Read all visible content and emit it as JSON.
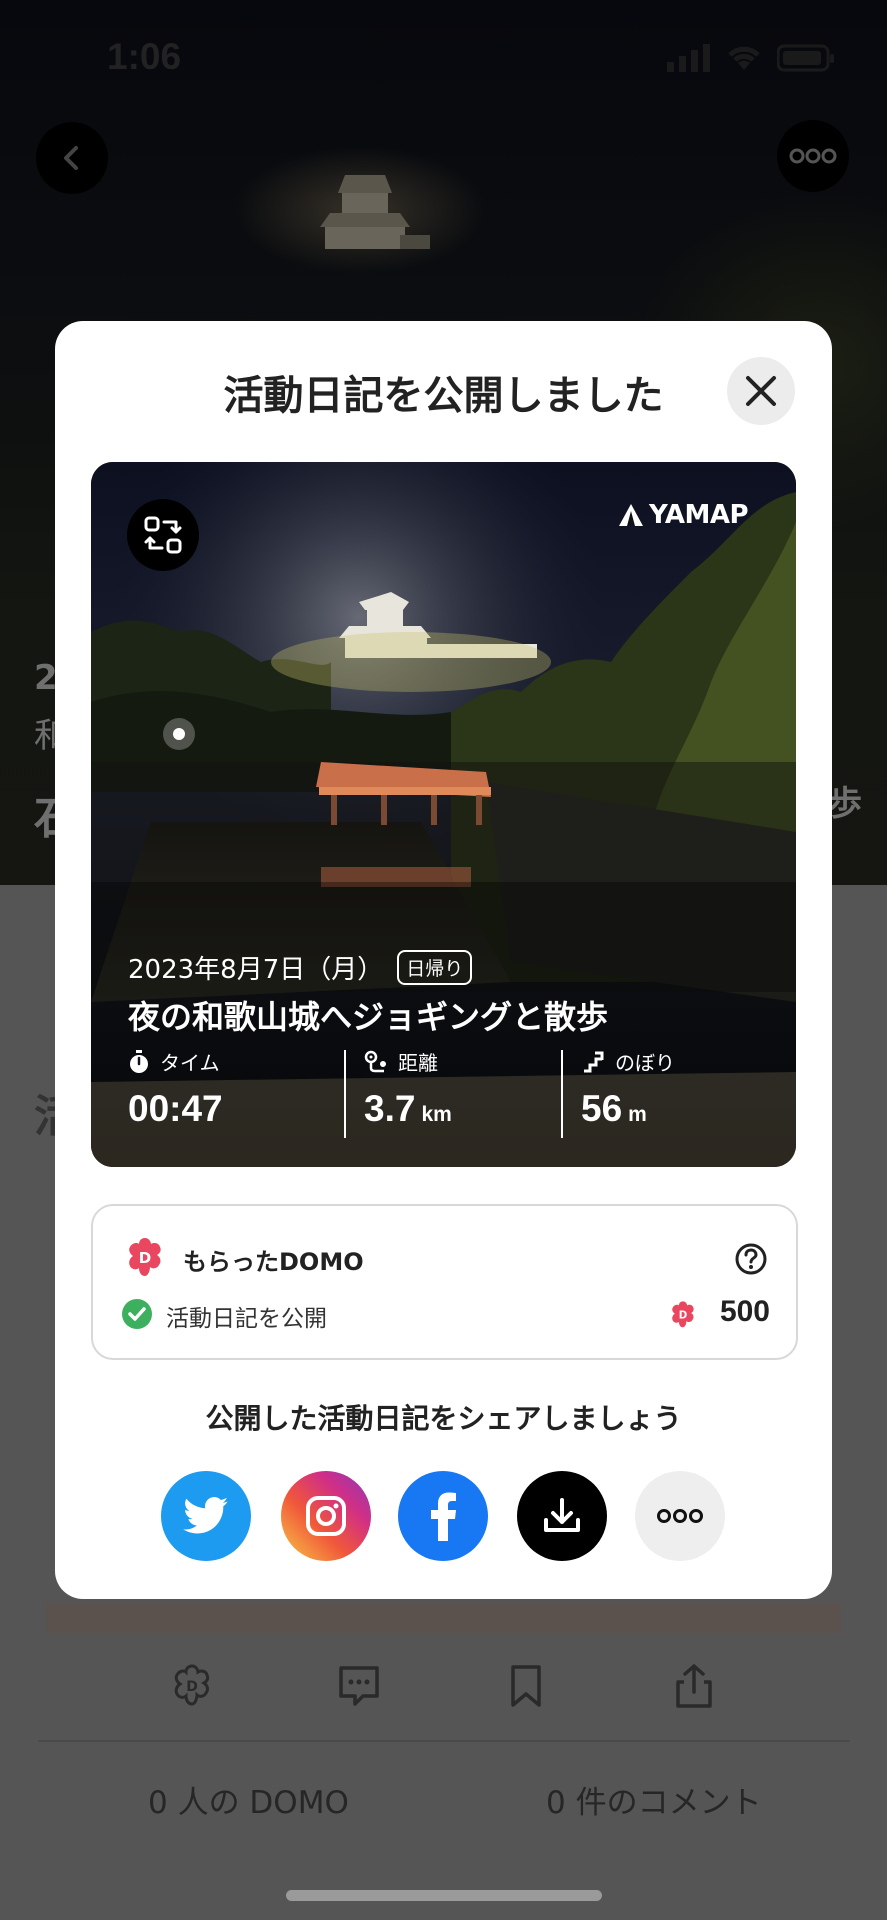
{
  "status_bar": {
    "time": "1:06"
  },
  "background": {
    "side_labels": [
      "2",
      "和",
      "石",
      "歩",
      "活"
    ],
    "bottom_counts": {
      "domo": "0 人の DOMO",
      "comments": "0 件のコメント"
    }
  },
  "modal": {
    "title": "活動日記を公開しました",
    "card": {
      "brand": "YAMAP",
      "date": "2023年8月7日（月）",
      "badge": "日帰り",
      "activity_title": "夜の和歌山城へジョギングと散歩",
      "stats": [
        {
          "label": "タイム",
          "value": "00:47",
          "unit": ""
        },
        {
          "label": "距離",
          "value": "3.7",
          "unit": "km"
        },
        {
          "label": "のぼり",
          "value": "56",
          "unit": "m"
        }
      ]
    },
    "domo": {
      "title": "もらったDOMO",
      "item_label": "活動日記を公開",
      "item_value": "500"
    },
    "share_prompt": "公開した活動日記をシェアしましょう",
    "share_buttons": [
      "twitter",
      "instagram",
      "facebook",
      "download",
      "more"
    ]
  },
  "colors": {
    "twitter": "#1d9bf0",
    "facebook": "#1877f2",
    "domo_pink": "#e9475f",
    "check_green": "#3db060"
  }
}
